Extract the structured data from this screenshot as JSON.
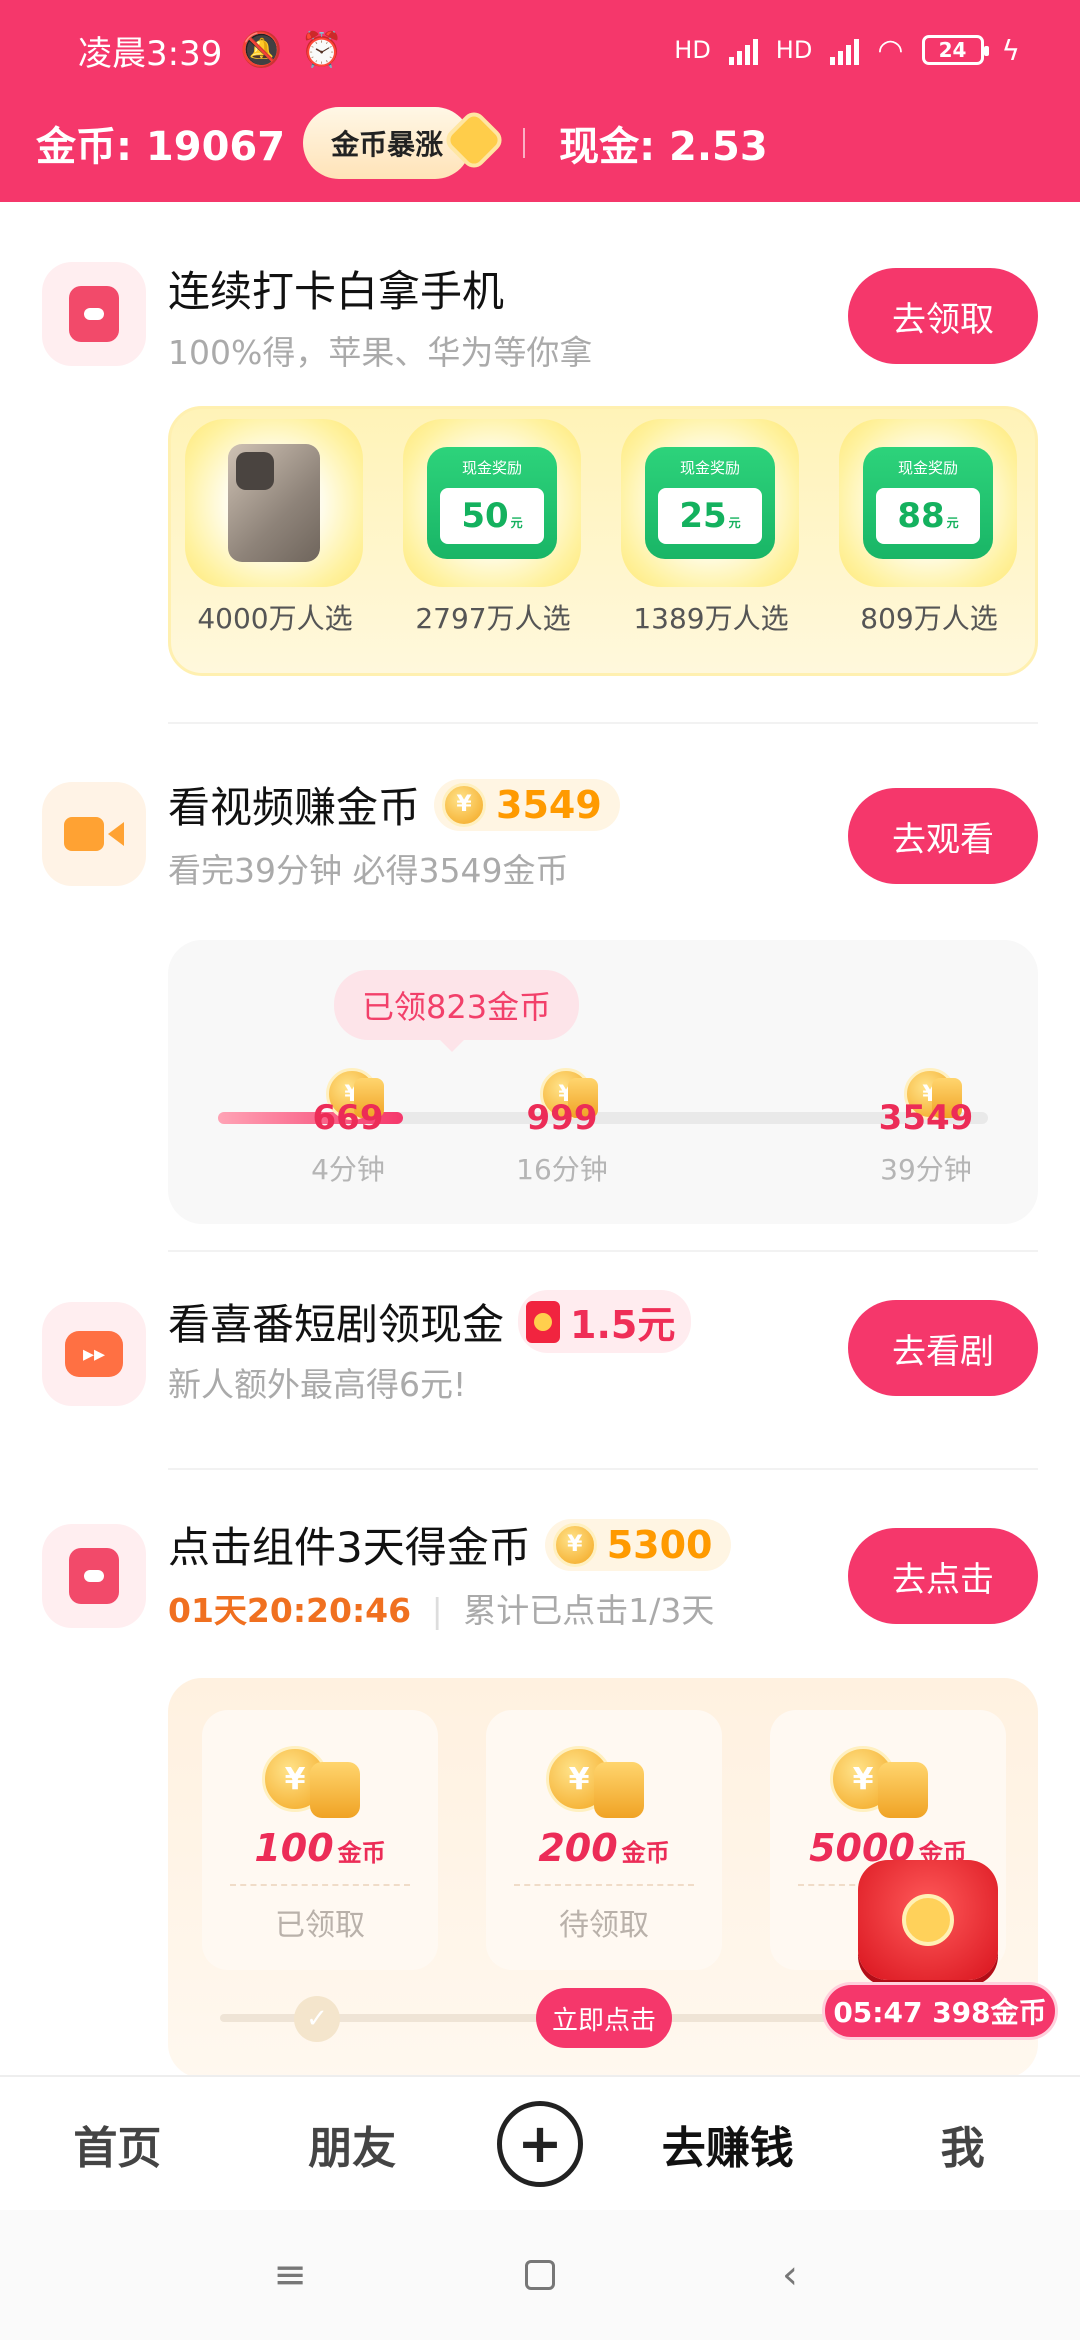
{
  "status_bar": {
    "time": "凌晨3:39",
    "network1": "HD",
    "network2": "HD",
    "battery": "24"
  },
  "header": {
    "coins_label": "金币: 19067",
    "boost_label": "金币暴涨",
    "cash_label": "现金: 2.53"
  },
  "tasks": {
    "checkin": {
      "title": "连续打卡白拿手机",
      "subtitle": "100%得，苹果、华为等你拿",
      "button": "去领取",
      "prizes": [
        {
          "kind": "phone",
          "votes": "4000万人选"
        },
        {
          "kind": "cash",
          "label": "现金奖励",
          "amount": "50",
          "unit": "元",
          "votes": "2797万人选"
        },
        {
          "kind": "cash",
          "label": "现金奖励",
          "amount": "25",
          "unit": "元",
          "votes": "1389万人选"
        },
        {
          "kind": "cash",
          "label": "现金奖励",
          "amount": "88",
          "unit": "元",
          "votes": "809万人选"
        }
      ]
    },
    "video": {
      "title": "看视频赚金币",
      "coins": "3549",
      "subtitle": "看完39分钟 必得3549金币",
      "button": "去观看",
      "claimed": "已领823金币",
      "progress_fraction": 0.24,
      "milestones": [
        {
          "value": "669",
          "time": "4分钟"
        },
        {
          "value": "999",
          "time": "16分钟"
        },
        {
          "value": "3549",
          "time": "39分钟"
        }
      ]
    },
    "drama": {
      "title": "看喜番短剧领现金",
      "cash": "1.5元",
      "subtitle": "新人额外最高得6元!",
      "button": "去看剧"
    },
    "widget": {
      "title": "点击组件3天得金币",
      "coins": "5300",
      "countdown": "01天20:20:46",
      "progress_text": "累计已点击1/3天",
      "button": "去点击",
      "rewards": [
        {
          "amount": "100",
          "unit": "金币",
          "status": "已领取"
        },
        {
          "amount": "200",
          "unit": "金币",
          "status": "待领取"
        },
        {
          "amount": "5000",
          "unit": "金币",
          "status": "待"
        }
      ],
      "click_now": "立即点击"
    }
  },
  "chest": {
    "timer": "05:47 398金币"
  },
  "nav": {
    "home": "首页",
    "friends": "朋友",
    "plus": "+",
    "earn": "去赚钱",
    "me": "我"
  },
  "icons": [
    "mute-icon",
    "alarm-icon",
    "signal-icon",
    "wifi-icon",
    "battery-icon",
    "coin-icon",
    "red-envelope-icon",
    "gift-chest-icon",
    "plus-icon",
    "menu-icon",
    "home-square-icon",
    "back-icon"
  ]
}
